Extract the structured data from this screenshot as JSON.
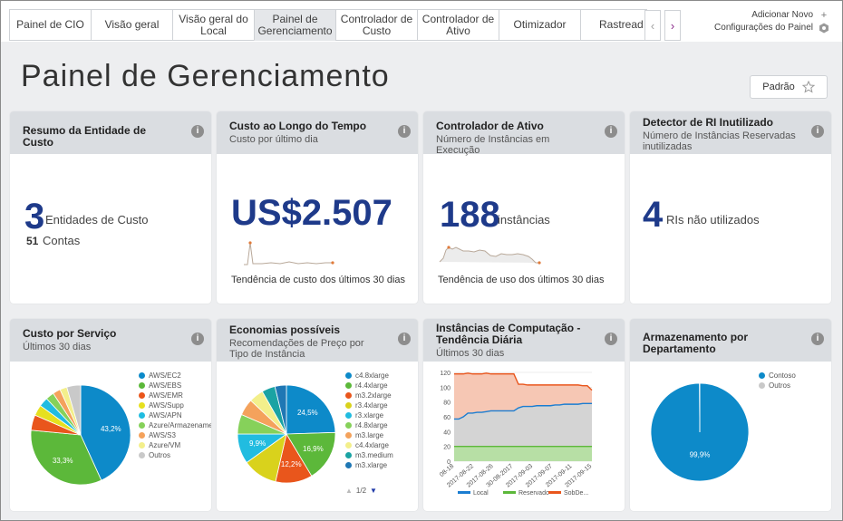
{
  "tabs": [
    {
      "label": "Painel de CIO",
      "active": false
    },
    {
      "label": "Visão geral",
      "active": false
    },
    {
      "label": "Visão geral do Local",
      "active": false
    },
    {
      "label": "Painel de Gerenciamento",
      "active": true
    },
    {
      "label": "Controlador de Custo",
      "active": false
    },
    {
      "label": "Controlador de Ativo",
      "active": false
    },
    {
      "label": "Otimizador",
      "active": false
    },
    {
      "label": "Rastread",
      "active": false
    }
  ],
  "top_right": {
    "add_new": "Adicionar Novo",
    "settings": "Configurações do Painel"
  },
  "page": {
    "title": "Painel de Gerenciamento",
    "default_button": "Padrão"
  },
  "colors": {
    "accent_blue": "#1e3a8a",
    "header_gray": "#dadde1",
    "pie_blue": "#0d8ac9",
    "pie_green": "#5cb83a",
    "pie_gray": "#c9c9c9"
  },
  "cards": {
    "entity": {
      "title": "Resumo da Entidade de Custo",
      "count": "3",
      "count_label": "Entidades de Custo",
      "accounts_count": "51",
      "accounts_label": "Contas"
    },
    "cost": {
      "title": "Custo ao Longo do Tempo",
      "subtitle": "Custo por último dia",
      "value": "US$2.507",
      "trend": "Tendência de custo dos últimos 30 dias"
    },
    "asset": {
      "title": "Controlador de Ativo",
      "subtitle": "Número de Instâncias em Execução",
      "value": "188",
      "unit": "instâncias",
      "trend": "Tendência de uso dos últimos 30 dias"
    },
    "ri": {
      "title": "Detector de RI Inutilizado",
      "subtitle": "Número de Instâncias Reservadas inutilizadas",
      "value": "4",
      "unit": "RIs não utilizados"
    },
    "service": {
      "title": "Custo por Serviço",
      "subtitle": "Últimos 30 dias"
    },
    "savings": {
      "title": "Economias possíveis",
      "subtitle": "Recomendações de Preço por Tipo de Instância",
      "pager": "1/2"
    },
    "compute": {
      "title": "Instâncias de Computação - Tendência Diária",
      "subtitle": "Últimos 30 dias"
    },
    "storage": {
      "title": "Armazenamento por Departamento"
    }
  },
  "chart_data": [
    {
      "type": "pie",
      "title": "Custo por Serviço",
      "categories": [
        "AWS/EC2",
        "AWS/EBS",
        "AWS/EMR",
        "AWS/Supp",
        "AWS/APN",
        "Azure/Armazenamento",
        "AWS/S3",
        "Azure/VM",
        "Outros"
      ],
      "values": [
        43.2,
        33.3,
        5.0,
        3.5,
        3.0,
        2.7,
        2.5,
        2.3,
        4.5
      ],
      "labels": [
        "43,2%",
        "33,3%",
        "",
        "",
        "",
        "",
        "",
        "",
        ""
      ],
      "colors": [
        "#0d8ac9",
        "#5cb83a",
        "#e9561c",
        "#e6e01f",
        "#21bce0",
        "#86d15a",
        "#f4a25c",
        "#f3ef8b",
        "#c9c9c9"
      ]
    },
    {
      "type": "pie",
      "title": "Economias possíveis",
      "categories": [
        "c4.8xlarge",
        "r4.4xlarge",
        "m3.2xlarge",
        "r3.4xlarge",
        "r3.xlarge",
        "r4.8xlarge",
        "m3.large",
        "c4.4xlarge",
        "m3.medium",
        "m3.xlarge"
      ],
      "values": [
        24.5,
        16.9,
        12.2,
        11.5,
        9.9,
        6.5,
        5.5,
        4.8,
        4.4,
        3.8
      ],
      "labels": [
        "24,5%",
        "16,9%",
        "12,2%",
        "",
        "9,9%",
        "",
        "",
        "",
        "",
        ""
      ],
      "colors": [
        "#0d8ac9",
        "#5cb83a",
        "#e9561c",
        "#d9d21c",
        "#21bce0",
        "#86d15a",
        "#f4a25c",
        "#f3ef8b",
        "#1aa3a3",
        "#1f77b4"
      ]
    },
    {
      "type": "area",
      "title": "Instâncias de Computação - Tendência Diária",
      "x": [
        "08-18",
        "2017-08-22",
        "2017-08-26",
        "30-08-2017",
        "2017-09-03",
        "2017-09-07",
        "2017-09-11",
        "2017-09-15"
      ],
      "ylim": [
        0,
        120
      ],
      "yticks": [
        0,
        20,
        40,
        60,
        80,
        100,
        120
      ],
      "series": [
        {
          "name": "Local",
          "color": "#1a7dd1",
          "values": [
            57,
            57,
            60,
            65,
            65,
            66,
            66,
            67,
            68,
            68,
            68,
            68,
            68,
            68,
            72,
            74,
            74,
            74,
            75,
            75,
            75,
            75,
            76,
            76,
            77,
            77,
            77,
            77,
            78,
            78,
            78
          ]
        },
        {
          "name": "Reservado",
          "color": "#5cb83a",
          "values": [
            20,
            20,
            20,
            20,
            20,
            20,
            20,
            20,
            20,
            20,
            20,
            20,
            20,
            20,
            20,
            20,
            20,
            20,
            20,
            20,
            20,
            20,
            20,
            20,
            20,
            20,
            20,
            20,
            20,
            20,
            20
          ]
        },
        {
          "name": "SobDe...",
          "color": "#e9561c",
          "values": [
            118,
            118,
            118,
            119,
            118,
            118,
            118,
            119,
            118,
            118,
            118,
            118,
            118,
            118,
            104,
            104,
            103,
            103,
            103,
            103,
            103,
            103,
            103,
            103,
            103,
            103,
            103,
            103,
            102,
            102,
            96
          ]
        }
      ]
    },
    {
      "type": "pie",
      "title": "Armazenamento por Departamento",
      "categories": [
        "Contoso",
        "Outros"
      ],
      "values": [
        99.9,
        0.1
      ],
      "labels": [
        "99,9%",
        ""
      ],
      "colors": [
        "#0d8ac9",
        "#c9c9c9"
      ]
    }
  ]
}
